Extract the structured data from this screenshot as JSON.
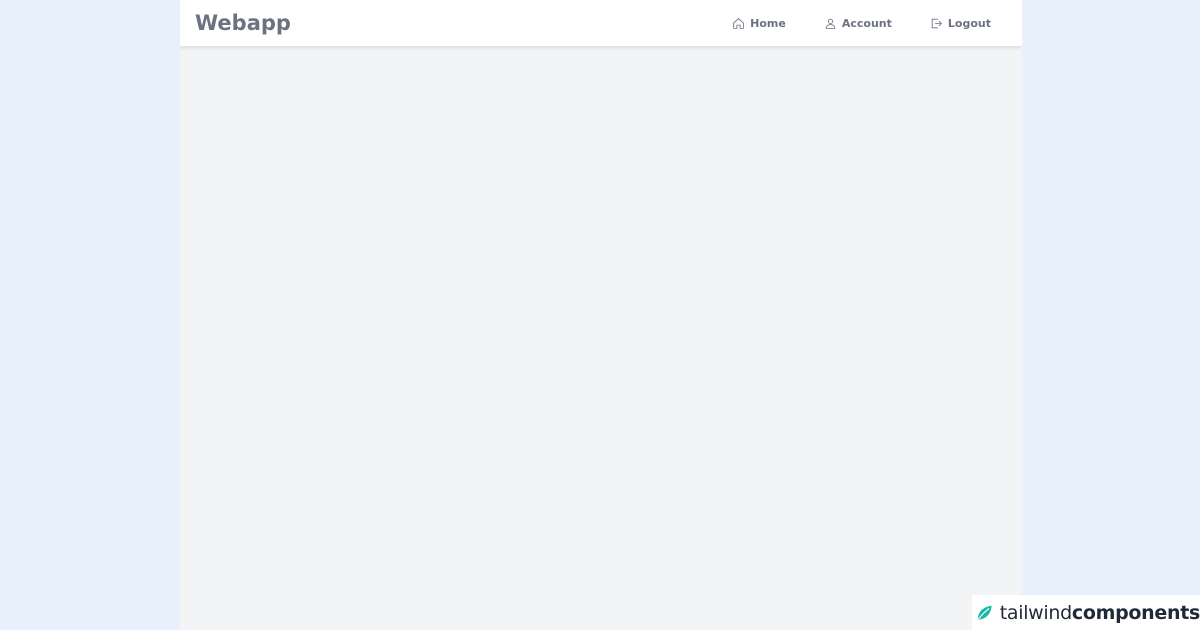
{
  "navbar": {
    "brand": "Webapp",
    "links": [
      {
        "label": "Home",
        "icon": "home-icon"
      },
      {
        "label": "Account",
        "icon": "user-icon"
      },
      {
        "label": "Logout",
        "icon": "logout-icon"
      }
    ]
  },
  "watermark": {
    "text_light": "tailwind",
    "text_bold": "components",
    "icon": "leaf-icon",
    "accent_color": "#14b8a6"
  },
  "colors": {
    "page_background": "#e8f1fb",
    "app_background": "#f3f4f6",
    "navbar_background": "#ffffff",
    "nav_text": "#6b7280"
  }
}
